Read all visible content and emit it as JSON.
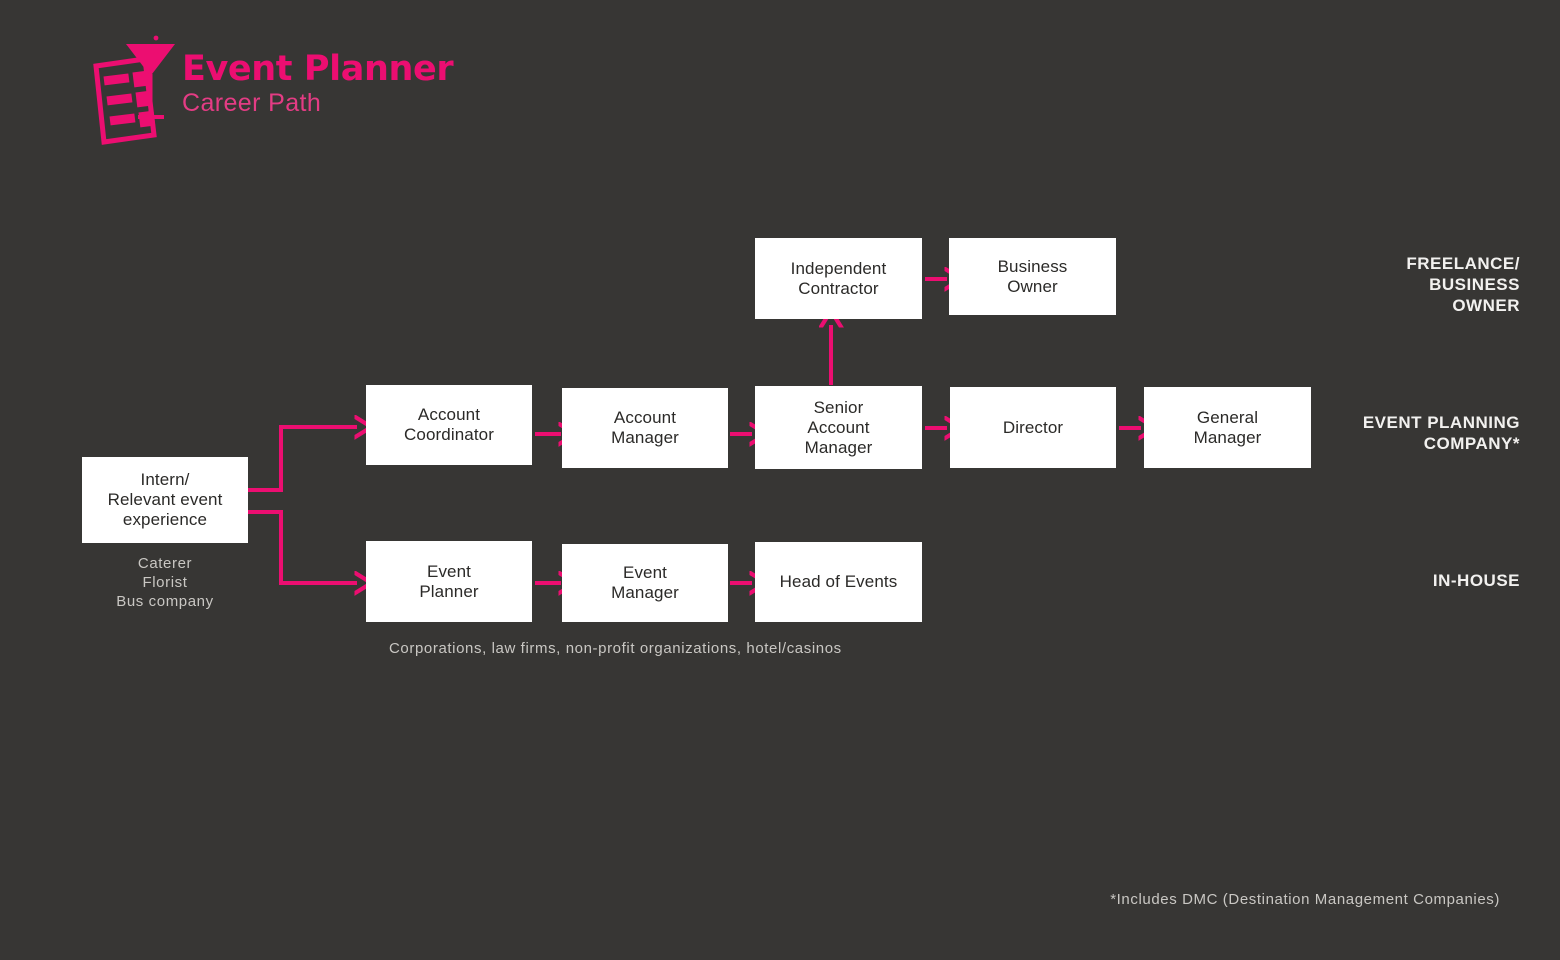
{
  "theme": {
    "background": "#373634",
    "accent": "#ec0e71",
    "accent_soft": "#e43c84",
    "node_fill": "#ffffff",
    "node_text": "#2b2a28",
    "label_text": "#f2f1ef",
    "caption_text": "#c9c7c3"
  },
  "header": {
    "title": "Event Planner",
    "subtitle": "Career Path",
    "logo_icon": "clipboard-martini-icon"
  },
  "diagram": {
    "start": {
      "label": "Intern/\nRelevant event\nexperience",
      "caption": "Caterer\nFlorist\nBus company"
    },
    "tracks": [
      {
        "id": "freelance",
        "label": "FREELANCE/\nBUSINESS\nOWNER",
        "nodes": [
          {
            "id": "independent-contractor",
            "label": "Independent\nContractor"
          },
          {
            "id": "business-owner",
            "label": "Business\nOwner"
          }
        ]
      },
      {
        "id": "event-planning-company",
        "label": "EVENT PLANNING\nCOMPANY*",
        "nodes": [
          {
            "id": "account-coordinator",
            "label": "Account\nCoordinator"
          },
          {
            "id": "account-manager",
            "label": "Account\nManager"
          },
          {
            "id": "senior-account-manager",
            "label": "Senior\nAccount\nManager"
          },
          {
            "id": "director",
            "label": "Director"
          },
          {
            "id": "general-manager",
            "label": "General\nManager"
          }
        ]
      },
      {
        "id": "in-house",
        "label": "IN-HOUSE",
        "caption": "Corporations, law firms, non-profit organizations, hotel/casinos",
        "nodes": [
          {
            "id": "event-planner",
            "label": "Event\nPlanner"
          },
          {
            "id": "event-manager",
            "label": "Event\nManager"
          },
          {
            "id": "head-of-events",
            "label": "Head of Events"
          }
        ]
      }
    ]
  },
  "footnote": "*Includes DMC (Destination Management Companies)"
}
